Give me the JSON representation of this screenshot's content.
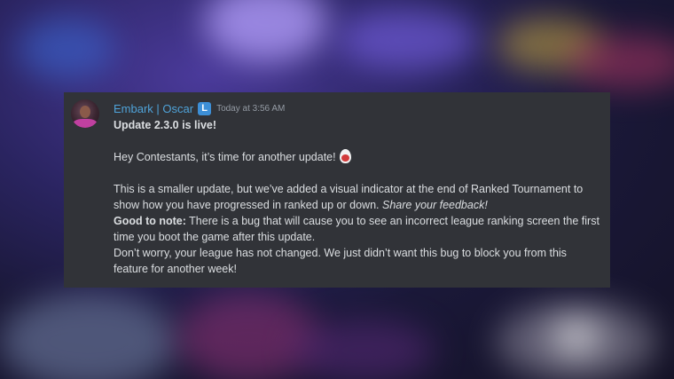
{
  "message": {
    "author": "Embark | Oscar",
    "role_badge": "L",
    "timestamp": "Today at 3:56 AM",
    "title": "Update 2.3.0 is live!",
    "greeting": "Hey Contestants, it’s time for another update!",
    "greeting_emoji": "egg-icon",
    "para1": "This is a smaller update, but we’ve added a visual indicator at the end of Ranked Tournament to show how you have progressed in ranked up or down.",
    "para1_italic": "Share your feedback!",
    "note_label": "Good to note:",
    "note_text": "There is a bug that will cause you to see an incorrect league ranking screen the first time you boot the game after this update.",
    "closing": "Don’t worry, your league has not changed. We just didn’t want this bug to block you from this feature for another week!"
  },
  "colors": {
    "card_background": "#313338",
    "username": "#4fa3d9",
    "role_badge": "#3d8fd6",
    "text": "#dbdee1",
    "timestamp": "#949ba4"
  }
}
